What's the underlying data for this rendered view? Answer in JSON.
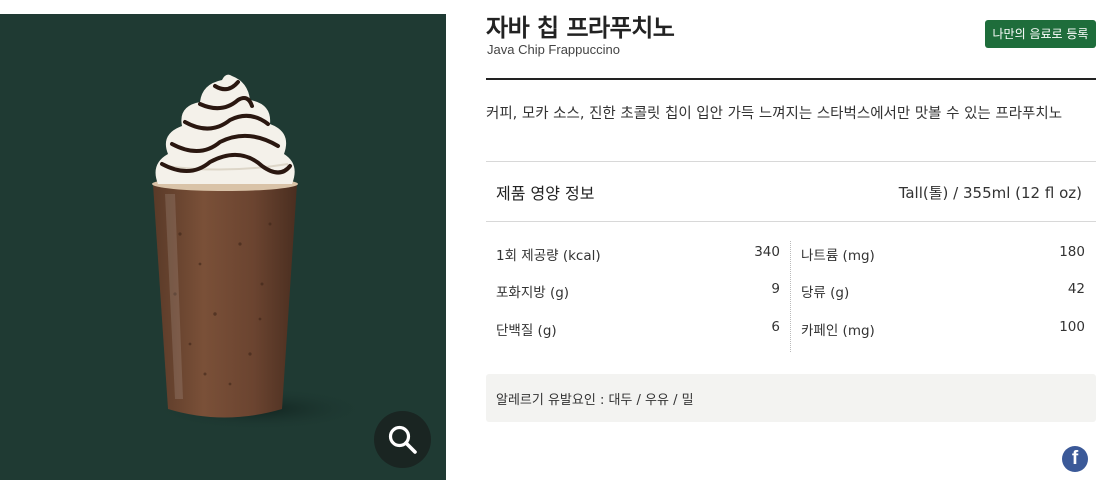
{
  "product": {
    "name_ko": "자바 칩 프라푸치노",
    "name_en": "Java Chip Frappuccino",
    "register_button": "나만의 음료로 등록",
    "description": "커피, 모카 소스, 진한 초콜릿 칩이 입안 가득 느껴지는 스타벅스에서만 맛볼 수 있는 프라푸치노"
  },
  "nutrition": {
    "title": "제품 영양 정보",
    "size": "Tall(톨) / 355ml (12 fl oz)",
    "left": [
      {
        "label": "1회 제공량 (kcal)",
        "value": "340"
      },
      {
        "label": "포화지방 (g)",
        "value": "9"
      },
      {
        "label": "단백질 (g)",
        "value": "6"
      }
    ],
    "right": [
      {
        "label": "나트륨 (mg)",
        "value": "180"
      },
      {
        "label": "당류 (g)",
        "value": "42"
      },
      {
        "label": "카페인 (mg)",
        "value": "100"
      }
    ]
  },
  "allergy": "알레르기 유발요인 : 대두 / 우유 / 밀",
  "icons": {
    "zoom": "magnifier-icon",
    "facebook": "facebook-icon"
  },
  "colors": {
    "image_background": "#1f3a33",
    "register_button": "#1e6d3b",
    "facebook": "#3b5998"
  }
}
